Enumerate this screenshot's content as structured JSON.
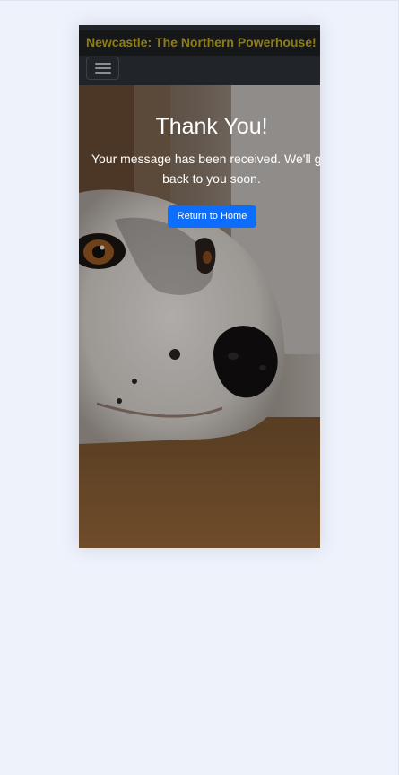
{
  "navbar": {
    "brand": "Newcastle: The Northern Powerhouse!",
    "toggler_icon": "hamburger-menu-icon",
    "brand_color": "#8f7e16",
    "background": "#212529"
  },
  "hero": {
    "heading": "Thank You!",
    "message": "Your message has been received. We'll get back to you soon.",
    "button_label": "Return to Home",
    "button_color": "#0d6efd"
  }
}
